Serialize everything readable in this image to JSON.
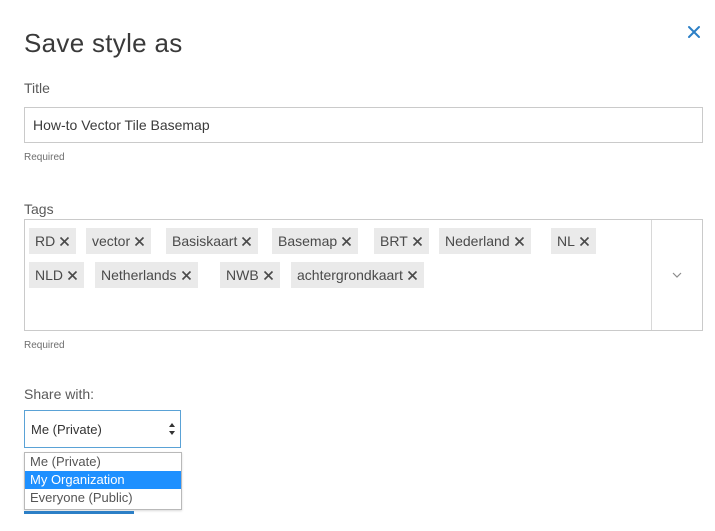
{
  "dialog": {
    "title": "Save style as"
  },
  "title_field": {
    "label": "Title",
    "value": "How-to Vector Tile Basemap",
    "hint": "Required"
  },
  "tags_field": {
    "label": "Tags",
    "hint": "Required",
    "tags": [
      "RD",
      "vector",
      "Basiskaart",
      "Basemap",
      "BRT",
      "Nederland",
      "NL",
      "NLD",
      "Netherlands",
      "NWB",
      "achtergrondkaart"
    ]
  },
  "share": {
    "label": "Share with:",
    "selected": "Me (Private)",
    "options": [
      "Me (Private)",
      "My Organization",
      "Everyone (Public)"
    ],
    "highlighted_index": 1
  },
  "colors": {
    "accent": "#2c7fc6",
    "highlight": "#1e90ff",
    "tag_bg": "#eaeaea",
    "border": "#cacaca"
  },
  "icons": {
    "close": "close-icon",
    "tag_remove": "x-icon",
    "tags_toggle": "chevron-down-icon",
    "select_arrows": "up-down-arrows-icon"
  }
}
